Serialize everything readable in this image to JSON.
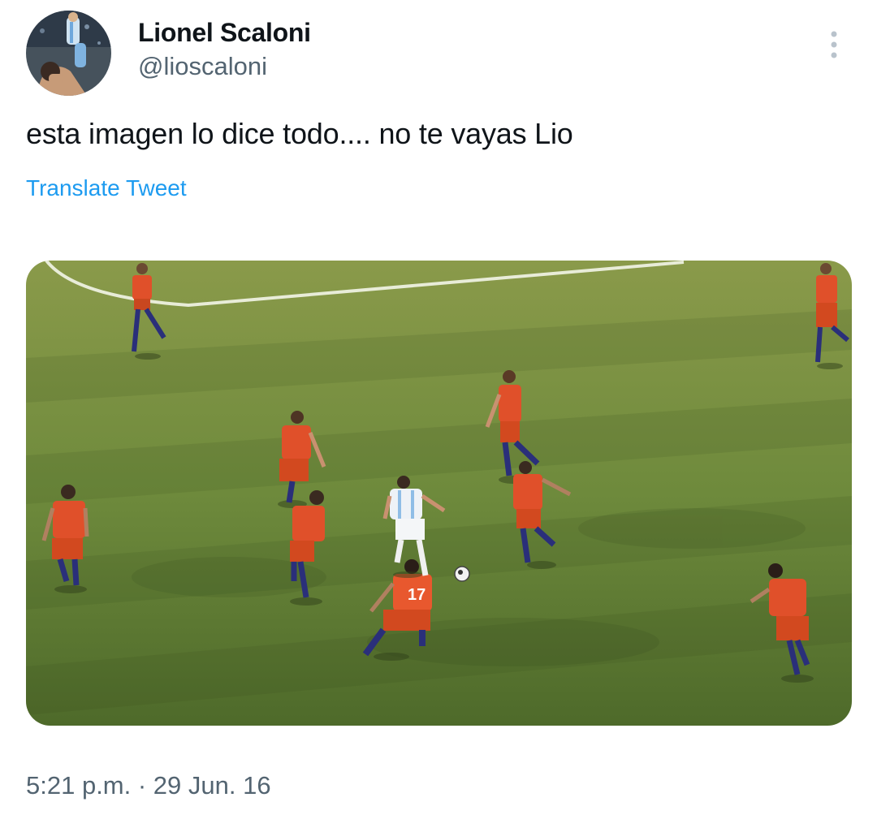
{
  "author": {
    "display_name": "Lionel Scaloni",
    "handle": "@lioscaloni"
  },
  "tweet": {
    "text": "esta imagen lo dice todo.... no te vayas Lio",
    "translate_label": "Translate Tweet",
    "timestamp": "5:21 p.m. · 29 Jun. 16"
  },
  "icons": {
    "more": "more-options-icon"
  },
  "colors": {
    "text_primary": "#0f1419",
    "text_secondary": "#536471",
    "link": "#1d9bf0",
    "pitch": "#6f8a3e",
    "kit_orange": "#e0502a",
    "kit_shorts": "#2a2f7a"
  }
}
